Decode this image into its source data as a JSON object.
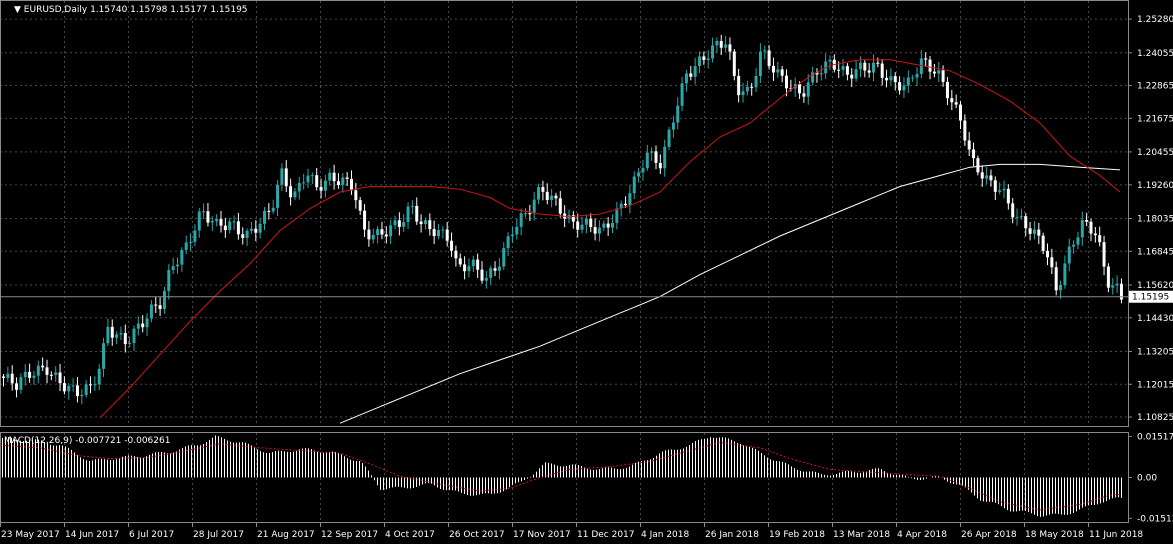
{
  "window": {
    "title": "EURUSD,Daily",
    "ohlc": "1.15740 1.15798 1.15177 1.15195"
  },
  "price_axis": {
    "ticks": [
      "1.25280",
      "1.24055",
      "1.22865",
      "1.21675",
      "1.20455",
      "1.19260",
      "1.18035",
      "1.16845",
      "1.15620",
      "1.14430",
      "1.13205",
      "1.12015",
      "1.10825"
    ],
    "current_price": "1.15195"
  },
  "macd": {
    "label": "MACD(12,26,9) -0.007721 -0.006261",
    "ticks": [
      "0.01517",
      "0.00",
      "-0.01513"
    ]
  },
  "time_axis": {
    "labels": [
      "23 May 2017",
      "14 Jun 2017",
      "6 Jul 2017",
      "28 Jul 2017",
      "21 Aug 2017",
      "12 Sep 2017",
      "4 Oct 2017",
      "26 Oct 2017",
      "17 Nov 2017",
      "11 Dec 2017",
      "4 Jan 2018",
      "26 Jan 2018",
      "19 Feb 2018",
      "13 Mar 2018",
      "4 Apr 2018",
      "26 Apr 2018",
      "18 May 2018",
      "11 Jun 2018"
    ]
  },
  "colors": {
    "background": "#000000",
    "grid": "#4a4a4a",
    "bull_candle": "#2aa7a7",
    "bear_candle": "#ffffff",
    "ma_fast": "#d01414",
    "ma_slow": "#ffffff",
    "macd_signal": "#d01414"
  },
  "chart_data": {
    "type": "candlestick",
    "symbol": "EURUSD",
    "timeframe": "Daily",
    "ylim": [
      1.105,
      1.259
    ],
    "close_path": [
      [
        0,
        1.123
      ],
      [
        15,
        1.119
      ],
      [
        30,
        1.124
      ],
      [
        45,
        1.127
      ],
      [
        60,
        1.121
      ],
      [
        75,
        1.116
      ],
      [
        90,
        1.118
      ],
      [
        100,
        1.129
      ],
      [
        106,
        1.142
      ],
      [
        115,
        1.139
      ],
      [
        125,
        1.136
      ],
      [
        140,
        1.141
      ],
      [
        150,
        1.146
      ],
      [
        160,
        1.15
      ],
      [
        170,
        1.164
      ],
      [
        185,
        1.171
      ],
      [
        200,
        1.182
      ],
      [
        215,
        1.177
      ],
      [
        230,
        1.179
      ],
      [
        245,
        1.175
      ],
      [
        260,
        1.179
      ],
      [
        270,
        1.183
      ],
      [
        280,
        1.196
      ],
      [
        292,
        1.188
      ],
      [
        305,
        1.199
      ],
      [
        315,
        1.192
      ],
      [
        328,
        1.194
      ],
      [
        340,
        1.193
      ],
      [
        352,
        1.192
      ],
      [
        362,
        1.177
      ],
      [
        375,
        1.175
      ],
      [
        388,
        1.176
      ],
      [
        400,
        1.178
      ],
      [
        410,
        1.184
      ],
      [
        420,
        1.179
      ],
      [
        435,
        1.177
      ],
      [
        448,
        1.173
      ],
      [
        456,
        1.161
      ],
      [
        470,
        1.163
      ],
      [
        485,
        1.159
      ],
      [
        500,
        1.167
      ],
      [
        510,
        1.176
      ],
      [
        525,
        1.181
      ],
      [
        540,
        1.191
      ],
      [
        555,
        1.187
      ],
      [
        570,
        1.179
      ],
      [
        585,
        1.177
      ],
      [
        600,
        1.175
      ],
      [
        615,
        1.183
      ],
      [
        630,
        1.192
      ],
      [
        645,
        1.203
      ],
      [
        660,
        1.199
      ],
      [
        670,
        1.215
      ],
      [
        685,
        1.234
      ],
      [
        700,
        1.238
      ],
      [
        715,
        1.242
      ],
      [
        725,
        1.244
      ],
      [
        735,
        1.228
      ],
      [
        748,
        1.227
      ],
      [
        760,
        1.242
      ],
      [
        775,
        1.232
      ],
      [
        790,
        1.227
      ],
      [
        800,
        1.226
      ],
      [
        815,
        1.235
      ],
      [
        830,
        1.237
      ],
      [
        845,
        1.231
      ],
      [
        860,
        1.235
      ],
      [
        875,
        1.237
      ],
      [
        890,
        1.23
      ],
      [
        905,
        1.227
      ],
      [
        920,
        1.237
      ],
      [
        935,
        1.235
      ],
      [
        945,
        1.228
      ],
      [
        960,
        1.215
      ],
      [
        970,
        1.2
      ],
      [
        985,
        1.194
      ],
      [
        1000,
        1.192
      ],
      [
        1015,
        1.181
      ],
      [
        1030,
        1.175
      ],
      [
        1045,
        1.168
      ],
      [
        1055,
        1.154
      ],
      [
        1065,
        1.167
      ],
      [
        1080,
        1.179
      ],
      [
        1095,
        1.174
      ],
      [
        1105,
        1.157
      ],
      [
        1115,
        1.155
      ],
      [
        1120,
        1.152
      ]
    ],
    "ma_fast_path": [
      [
        100,
        1.108
      ],
      [
        130,
        1.119
      ],
      [
        160,
        1.131
      ],
      [
        190,
        1.143
      ],
      [
        220,
        1.154
      ],
      [
        250,
        1.164
      ],
      [
        280,
        1.176
      ],
      [
        310,
        1.184
      ],
      [
        340,
        1.19
      ],
      [
        370,
        1.192
      ],
      [
        400,
        1.192
      ],
      [
        430,
        1.192
      ],
      [
        460,
        1.191
      ],
      [
        490,
        1.188
      ],
      [
        510,
        1.184
      ],
      [
        540,
        1.182
      ],
      [
        570,
        1.181
      ],
      [
        600,
        1.182
      ],
      [
        630,
        1.185
      ],
      [
        660,
        1.19
      ],
      [
        690,
        1.201
      ],
      [
        720,
        1.21
      ],
      [
        750,
        1.215
      ],
      [
        770,
        1.221
      ],
      [
        790,
        1.227
      ],
      [
        810,
        1.232
      ],
      [
        830,
        1.236
      ],
      [
        860,
        1.238
      ],
      [
        890,
        1.238
      ],
      [
        920,
        1.236
      ],
      [
        950,
        1.234
      ],
      [
        980,
        1.229
      ],
      [
        1010,
        1.223
      ],
      [
        1040,
        1.215
      ],
      [
        1070,
        1.203
      ],
      [
        1100,
        1.196
      ],
      [
        1120,
        1.19
      ]
    ],
    "ma_slow_path": [
      [
        340,
        1.106
      ],
      [
        380,
        1.112
      ],
      [
        420,
        1.118
      ],
      [
        460,
        1.124
      ],
      [
        500,
        1.129
      ],
      [
        540,
        1.134
      ],
      [
        580,
        1.14
      ],
      [
        620,
        1.146
      ],
      [
        660,
        1.152
      ],
      [
        700,
        1.16
      ],
      [
        740,
        1.167
      ],
      [
        780,
        1.174
      ],
      [
        820,
        1.18
      ],
      [
        860,
        1.186
      ],
      [
        900,
        1.192
      ],
      [
        940,
        1.196
      ],
      [
        970,
        1.199
      ],
      [
        1000,
        1.2
      ],
      [
        1040,
        1.2
      ],
      [
        1080,
        1.199
      ],
      [
        1120,
        1.198
      ]
    ],
    "macd_hist_path": [
      [
        0,
        0.0145
      ],
      [
        30,
        0.014
      ],
      [
        60,
        0.012
      ],
      [
        90,
        0.006
      ],
      [
        110,
        0.007
      ],
      [
        140,
        0.008
      ],
      [
        170,
        0.0095
      ],
      [
        200,
        0.0125
      ],
      [
        215,
        0.015
      ],
      [
        240,
        0.013
      ],
      [
        270,
        0.009
      ],
      [
        300,
        0.0105
      ],
      [
        330,
        0.0095
      ],
      [
        360,
        0.006
      ],
      [
        380,
        -0.004
      ],
      [
        400,
        -0.004
      ],
      [
        430,
        -0.0025
      ],
      [
        460,
        -0.006
      ],
      [
        490,
        -0.0065
      ],
      [
        520,
        -0.002
      ],
      [
        545,
        0.005
      ],
      [
        570,
        0.0045
      ],
      [
        600,
        0.003
      ],
      [
        630,
        0.004
      ],
      [
        660,
        0.009
      ],
      [
        690,
        0.012
      ],
      [
        710,
        0.0155
      ],
      [
        740,
        0.013
      ],
      [
        760,
        0.009
      ],
      [
        790,
        0.004
      ],
      [
        820,
        0.001
      ],
      [
        850,
        0.002
      ],
      [
        880,
        0.003
      ],
      [
        910,
        -0.0005
      ],
      [
        940,
        0.0
      ],
      [
        960,
        -0.003
      ],
      [
        980,
        -0.008
      ],
      [
        1010,
        -0.012
      ],
      [
        1040,
        -0.014
      ],
      [
        1060,
        -0.014
      ],
      [
        1080,
        -0.012
      ],
      [
        1100,
        -0.009
      ],
      [
        1120,
        -0.0077
      ]
    ],
    "macd_signal_path": [
      [
        0,
        0.012
      ],
      [
        40,
        0.011
      ],
      [
        80,
        0.008
      ],
      [
        110,
        0.007
      ],
      [
        150,
        0.0075
      ],
      [
        180,
        0.0095
      ],
      [
        220,
        0.0125
      ],
      [
        260,
        0.011
      ],
      [
        300,
        0.01
      ],
      [
        340,
        0.009
      ],
      [
        370,
        0.005
      ],
      [
        400,
        0.0005
      ],
      [
        440,
        -0.0025
      ],
      [
        480,
        -0.005
      ],
      [
        510,
        -0.004
      ],
      [
        540,
        0.0
      ],
      [
        570,
        0.003
      ],
      [
        610,
        0.004
      ],
      [
        650,
        0.006
      ],
      [
        690,
        0.01
      ],
      [
        720,
        0.013
      ],
      [
        760,
        0.011
      ],
      [
        790,
        0.007
      ],
      [
        830,
        0.003
      ],
      [
        870,
        0.002
      ],
      [
        910,
        0.001
      ],
      [
        940,
        0.0005
      ],
      [
        970,
        -0.004
      ],
      [
        1000,
        -0.009
      ],
      [
        1040,
        -0.012
      ],
      [
        1080,
        -0.01
      ],
      [
        1110,
        -0.0065
      ],
      [
        1120,
        -0.0063
      ]
    ]
  }
}
